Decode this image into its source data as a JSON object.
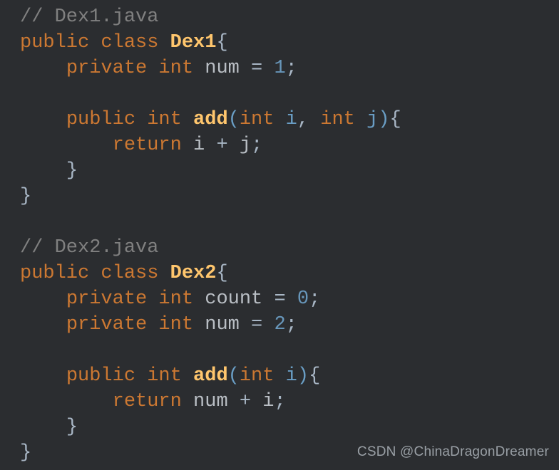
{
  "editor": {
    "theme_name": "darcula",
    "background_color": "#2b2d30",
    "language": "java",
    "colors": {
      "comment": "#808080",
      "keyword": "#cc7832",
      "class_name": "#ffc66d",
      "method_name": "#ffc66d",
      "field": "#b9bec4",
      "parameter": "#6a9ec5",
      "number": "#6897bb",
      "punctuation": "#a9b7c6"
    },
    "lines": [
      {
        "n": 1,
        "text": "// Dex1.java",
        "tokens": [
          {
            "t": "// Dex1.java",
            "c": "tok-comment"
          }
        ]
      },
      {
        "n": 2,
        "text": "public class Dex1{",
        "tokens": [
          {
            "t": "public class ",
            "c": "tok-keyword"
          },
          {
            "t": "Dex1",
            "c": "tok-class"
          },
          {
            "t": "{",
            "c": "tok-punct"
          }
        ]
      },
      {
        "n": 3,
        "text": "    private int num = 1;",
        "tokens": [
          {
            "t": "    ",
            "c": "tok-plain"
          },
          {
            "t": "private int ",
            "c": "tok-keyword"
          },
          {
            "t": "num",
            "c": "tok-field"
          },
          {
            "t": " = ",
            "c": "tok-op"
          },
          {
            "t": "1",
            "c": "tok-number"
          },
          {
            "t": ";",
            "c": "tok-punct"
          }
        ]
      },
      {
        "n": 4,
        "text": "",
        "tokens": []
      },
      {
        "n": 5,
        "text": "    public int add(int i, int j){",
        "tokens": [
          {
            "t": "    ",
            "c": "tok-plain"
          },
          {
            "t": "public int ",
            "c": "tok-keyword"
          },
          {
            "t": "add",
            "c": "tok-method"
          },
          {
            "t": "(",
            "c": "tok-paren"
          },
          {
            "t": "int ",
            "c": "tok-type"
          },
          {
            "t": "i",
            "c": "tok-param"
          },
          {
            "t": ", ",
            "c": "tok-punct"
          },
          {
            "t": "int ",
            "c": "tok-type"
          },
          {
            "t": "j",
            "c": "tok-param"
          },
          {
            "t": ")",
            "c": "tok-paren"
          },
          {
            "t": "{",
            "c": "tok-punct"
          }
        ]
      },
      {
        "n": 6,
        "text": "        return i + j;",
        "tokens": [
          {
            "t": "        ",
            "c": "tok-plain"
          },
          {
            "t": "return ",
            "c": "tok-keyword"
          },
          {
            "t": "i",
            "c": "tok-var"
          },
          {
            "t": " + ",
            "c": "tok-op"
          },
          {
            "t": "j",
            "c": "tok-var"
          },
          {
            "t": ";",
            "c": "tok-punct"
          }
        ]
      },
      {
        "n": 7,
        "text": "    }",
        "tokens": [
          {
            "t": "    ",
            "c": "tok-plain"
          },
          {
            "t": "}",
            "c": "tok-punct"
          }
        ]
      },
      {
        "n": 8,
        "text": "}",
        "tokens": [
          {
            "t": "}",
            "c": "tok-punct"
          }
        ]
      },
      {
        "n": 9,
        "text": "",
        "tokens": []
      },
      {
        "n": 10,
        "text": "// Dex2.java",
        "tokens": [
          {
            "t": "// Dex2.java",
            "c": "tok-comment"
          }
        ]
      },
      {
        "n": 11,
        "text": "public class Dex2{",
        "tokens": [
          {
            "t": "public class ",
            "c": "tok-keyword"
          },
          {
            "t": "Dex2",
            "c": "tok-class"
          },
          {
            "t": "{",
            "c": "tok-punct"
          }
        ]
      },
      {
        "n": 12,
        "text": "    private int count = 0;",
        "tokens": [
          {
            "t": "    ",
            "c": "tok-plain"
          },
          {
            "t": "private int ",
            "c": "tok-keyword"
          },
          {
            "t": "count",
            "c": "tok-field"
          },
          {
            "t": " = ",
            "c": "tok-op"
          },
          {
            "t": "0",
            "c": "tok-number"
          },
          {
            "t": ";",
            "c": "tok-punct"
          }
        ]
      },
      {
        "n": 13,
        "text": "    private int num = 2;",
        "tokens": [
          {
            "t": "    ",
            "c": "tok-plain"
          },
          {
            "t": "private int ",
            "c": "tok-keyword"
          },
          {
            "t": "num",
            "c": "tok-field"
          },
          {
            "t": " = ",
            "c": "tok-op"
          },
          {
            "t": "2",
            "c": "tok-number"
          },
          {
            "t": ";",
            "c": "tok-punct"
          }
        ]
      },
      {
        "n": 14,
        "text": "",
        "tokens": []
      },
      {
        "n": 15,
        "text": "    public int add(int i){",
        "tokens": [
          {
            "t": "    ",
            "c": "tok-plain"
          },
          {
            "t": "public int ",
            "c": "tok-keyword"
          },
          {
            "t": "add",
            "c": "tok-method"
          },
          {
            "t": "(",
            "c": "tok-paren"
          },
          {
            "t": "int ",
            "c": "tok-type"
          },
          {
            "t": "i",
            "c": "tok-param"
          },
          {
            "t": ")",
            "c": "tok-paren"
          },
          {
            "t": "{",
            "c": "tok-punct"
          }
        ]
      },
      {
        "n": 16,
        "text": "        return num + i;",
        "tokens": [
          {
            "t": "        ",
            "c": "tok-plain"
          },
          {
            "t": "return ",
            "c": "tok-keyword"
          },
          {
            "t": "num",
            "c": "tok-var"
          },
          {
            "t": " + ",
            "c": "tok-op"
          },
          {
            "t": "i",
            "c": "tok-var"
          },
          {
            "t": ";",
            "c": "tok-punct"
          }
        ]
      },
      {
        "n": 17,
        "text": "    }",
        "tokens": [
          {
            "t": "    ",
            "c": "tok-plain"
          },
          {
            "t": "}",
            "c": "tok-punct"
          }
        ]
      },
      {
        "n": 18,
        "text": "}",
        "tokens": [
          {
            "t": "}",
            "c": "tok-punct"
          }
        ]
      }
    ]
  },
  "watermark": {
    "text": "CSDN @ChinaDragonDreamer"
  }
}
